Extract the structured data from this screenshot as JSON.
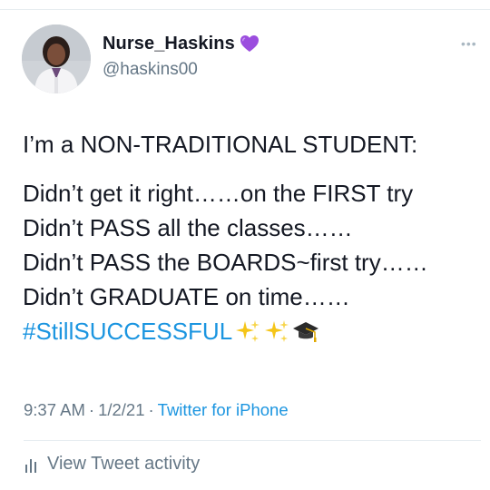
{
  "user": {
    "display_name": "Nurse_Haskins",
    "handle": "@haskins00",
    "badge_emoji": "purple-heart-icon"
  },
  "tweet": {
    "intro": "I’m a NON-TRADITIONAL STUDENT:",
    "lines": [
      "Didn’t get it right……on the FIRST try",
      "Didn’t PASS all the classes……",
      "Didn’t PASS the BOARDS~first try……",
      "Didn’t GRADUATE on time……"
    ],
    "hashtag": "#StillSUCCESSFUL",
    "trailing_emojis": [
      "sparkles-icon",
      "sparkles-icon",
      "graduation-cap-icon"
    ]
  },
  "meta": {
    "time": "9:37 AM",
    "date": "1/2/21",
    "separator": "·",
    "source": "Twitter for iPhone"
  },
  "activity": {
    "label": "View Tweet activity"
  },
  "colors": {
    "link": "#1b95e0",
    "muted": "#657786",
    "text": "#141823",
    "divider": "#e6ecf0",
    "heart": "#9b4dde"
  }
}
